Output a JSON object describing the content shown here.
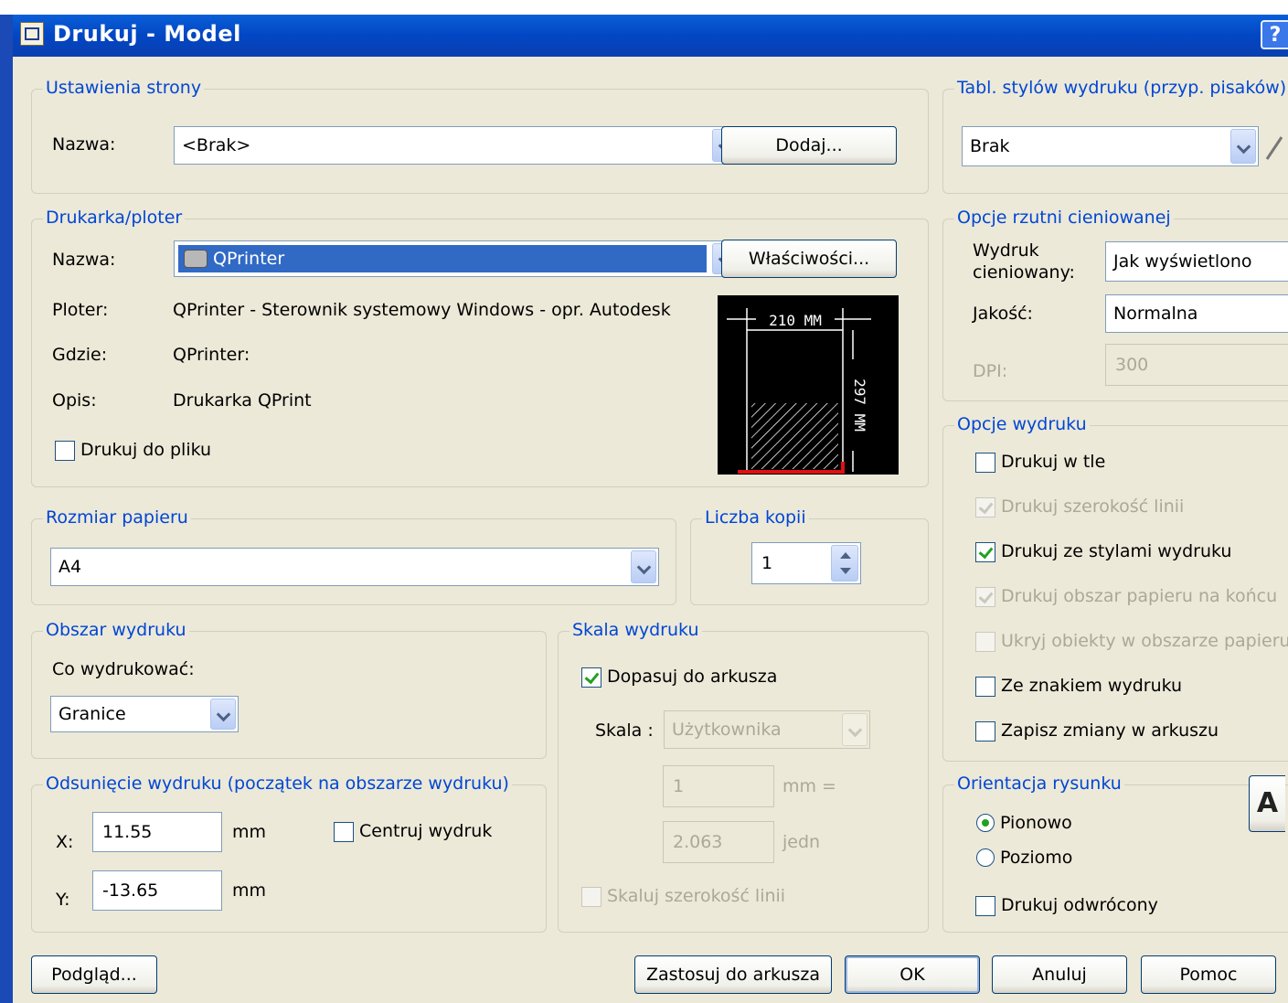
{
  "window": {
    "title": "Drukuj - Model",
    "help_label": "?"
  },
  "page_setup": {
    "legend": "Ustawienia strony",
    "name_label": "Nazwa:",
    "name_value": "<Brak>",
    "add_button": "Dodaj..."
  },
  "printer": {
    "legend": "Drukarka/ploter",
    "name_label": "Nazwa:",
    "name_value": "QPrinter",
    "properties_button": "Właściwości...",
    "plotter_label": "Ploter:",
    "plotter_value": "QPrinter - Sterownik systemowy Windows - opr. Autodesk",
    "where_label": "Gdzie:",
    "where_value": "QPrinter:",
    "description_label": "Opis:",
    "description_value": "Drukarka QPrint",
    "print_to_file": {
      "label": "Drukuj do pliku",
      "checked": false
    },
    "preview_width": "210 MM",
    "preview_height": "297 MM"
  },
  "paper_size": {
    "legend": "Rozmiar papieru",
    "value": "A4"
  },
  "copies": {
    "legend": "Liczba kopii",
    "value": "1"
  },
  "plot_area": {
    "legend": "Obszar wydruku",
    "what_label": "Co wydrukować:",
    "what_value": "Granice"
  },
  "plot_offset": {
    "legend": "Odsunięcie wydruku (początek na obszarze wydruku)",
    "x_label": "X:",
    "x_value": "11.55",
    "x_unit": "mm",
    "y_label": "Y:",
    "y_value": "-13.65",
    "y_unit": "mm",
    "center": {
      "label": "Centruj wydruk",
      "checked": false
    }
  },
  "plot_scale": {
    "legend": "Skala wydruku",
    "fit": {
      "label": "Dopasuj do arkusza",
      "checked": true
    },
    "scale_label": "Skala :",
    "scale_value": "Użytkownika",
    "value1": "1",
    "unit1": "mm =",
    "value2": "2.063",
    "unit2": "jedn",
    "scale_lineweights": {
      "label": "Skaluj szerokość linii",
      "checked": false
    }
  },
  "style_table": {
    "legend": "Tabl. stylów wydruku (przyp. pisaków)",
    "value": "Brak"
  },
  "shaded_viewport": {
    "legend": "Opcje rzutni cieniowanej",
    "shade_label": "Wydruk cieniowany:",
    "shade_value": "Jak wyświetlono",
    "quality_label": "Jakość:",
    "quality_value": "Normalna",
    "dpi_label": "DPI:",
    "dpi_value": "300"
  },
  "plot_options": {
    "legend": "Opcje wydruku",
    "items": [
      {
        "label": "Drukuj w tle",
        "checked": false,
        "enabled": true
      },
      {
        "label": "Drukuj szerokość linii",
        "checked": true,
        "enabled": false
      },
      {
        "label": "Drukuj ze stylami wydruku",
        "checked": true,
        "enabled": true
      },
      {
        "label": "Drukuj obszar papieru na końcu",
        "checked": true,
        "enabled": false
      },
      {
        "label": "Ukryj obiekty w obszarze papieru",
        "checked": false,
        "enabled": false
      },
      {
        "label": "Ze znakiem wydruku",
        "checked": false,
        "enabled": true
      },
      {
        "label": "Zapisz zmiany w arkuszu",
        "checked": false,
        "enabled": true
      }
    ]
  },
  "orientation": {
    "legend": "Orientacja rysunku",
    "portrait": {
      "label": "Pionowo",
      "selected": true
    },
    "landscape": {
      "label": "Poziomo",
      "selected": false
    },
    "upside_down": {
      "label": "Drukuj odwrócony",
      "checked": false
    },
    "icon_letter": "A"
  },
  "buttons": {
    "preview": "Podgląd...",
    "apply": "Zastosuj do arkusza",
    "ok": "OK",
    "cancel": "Anuluj",
    "help": "Pomoc"
  }
}
